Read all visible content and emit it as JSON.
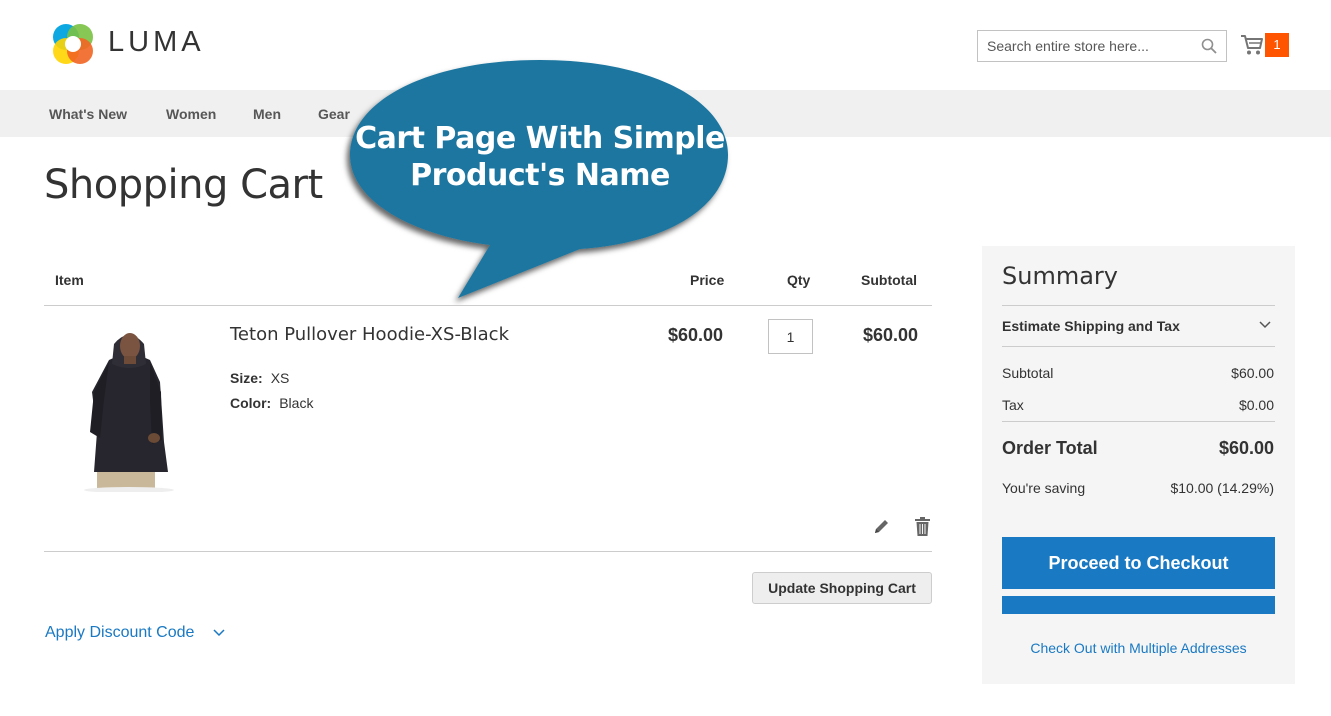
{
  "header": {
    "logo_text": "LUMA",
    "search_placeholder": "Search entire store here...",
    "cart_count": "1"
  },
  "nav": {
    "items": [
      "What's New",
      "Women",
      "Men",
      "Gear"
    ]
  },
  "page_title": "Shopping Cart",
  "callout": {
    "line1": "Cart Page With Simple",
    "line2": "Product's Name"
  },
  "cart": {
    "headers": {
      "item": "Item",
      "price": "Price",
      "qty": "Qty",
      "subtotal": "Subtotal"
    },
    "items": [
      {
        "name": "Teton Pullover Hoodie-XS-Black",
        "options": [
          {
            "label": "Size:",
            "value": "XS"
          },
          {
            "label": "Color:",
            "value": "Black"
          }
        ],
        "price": "$60.00",
        "qty": "1",
        "subtotal": "$60.00"
      }
    ],
    "update_label": "Update Shopping Cart",
    "discount_label": "Apply Discount Code"
  },
  "summary": {
    "title": "Summary",
    "estimate_label": "Estimate Shipping and Tax",
    "subtotal_label": "Subtotal",
    "subtotal_value": "$60.00",
    "tax_label": "Tax",
    "tax_value": "$0.00",
    "order_total_label": "Order Total",
    "order_total_value": "$60.00",
    "saving_label": "You're saving",
    "saving_value": "$10.00 (14.29%)",
    "checkout_label": "Proceed to Checkout",
    "multi_label": "Check Out with Multiple Addresses"
  },
  "colors": {
    "accent": "#1979c3",
    "cart_badge": "#ff5501",
    "callout": "#1a76a0"
  }
}
